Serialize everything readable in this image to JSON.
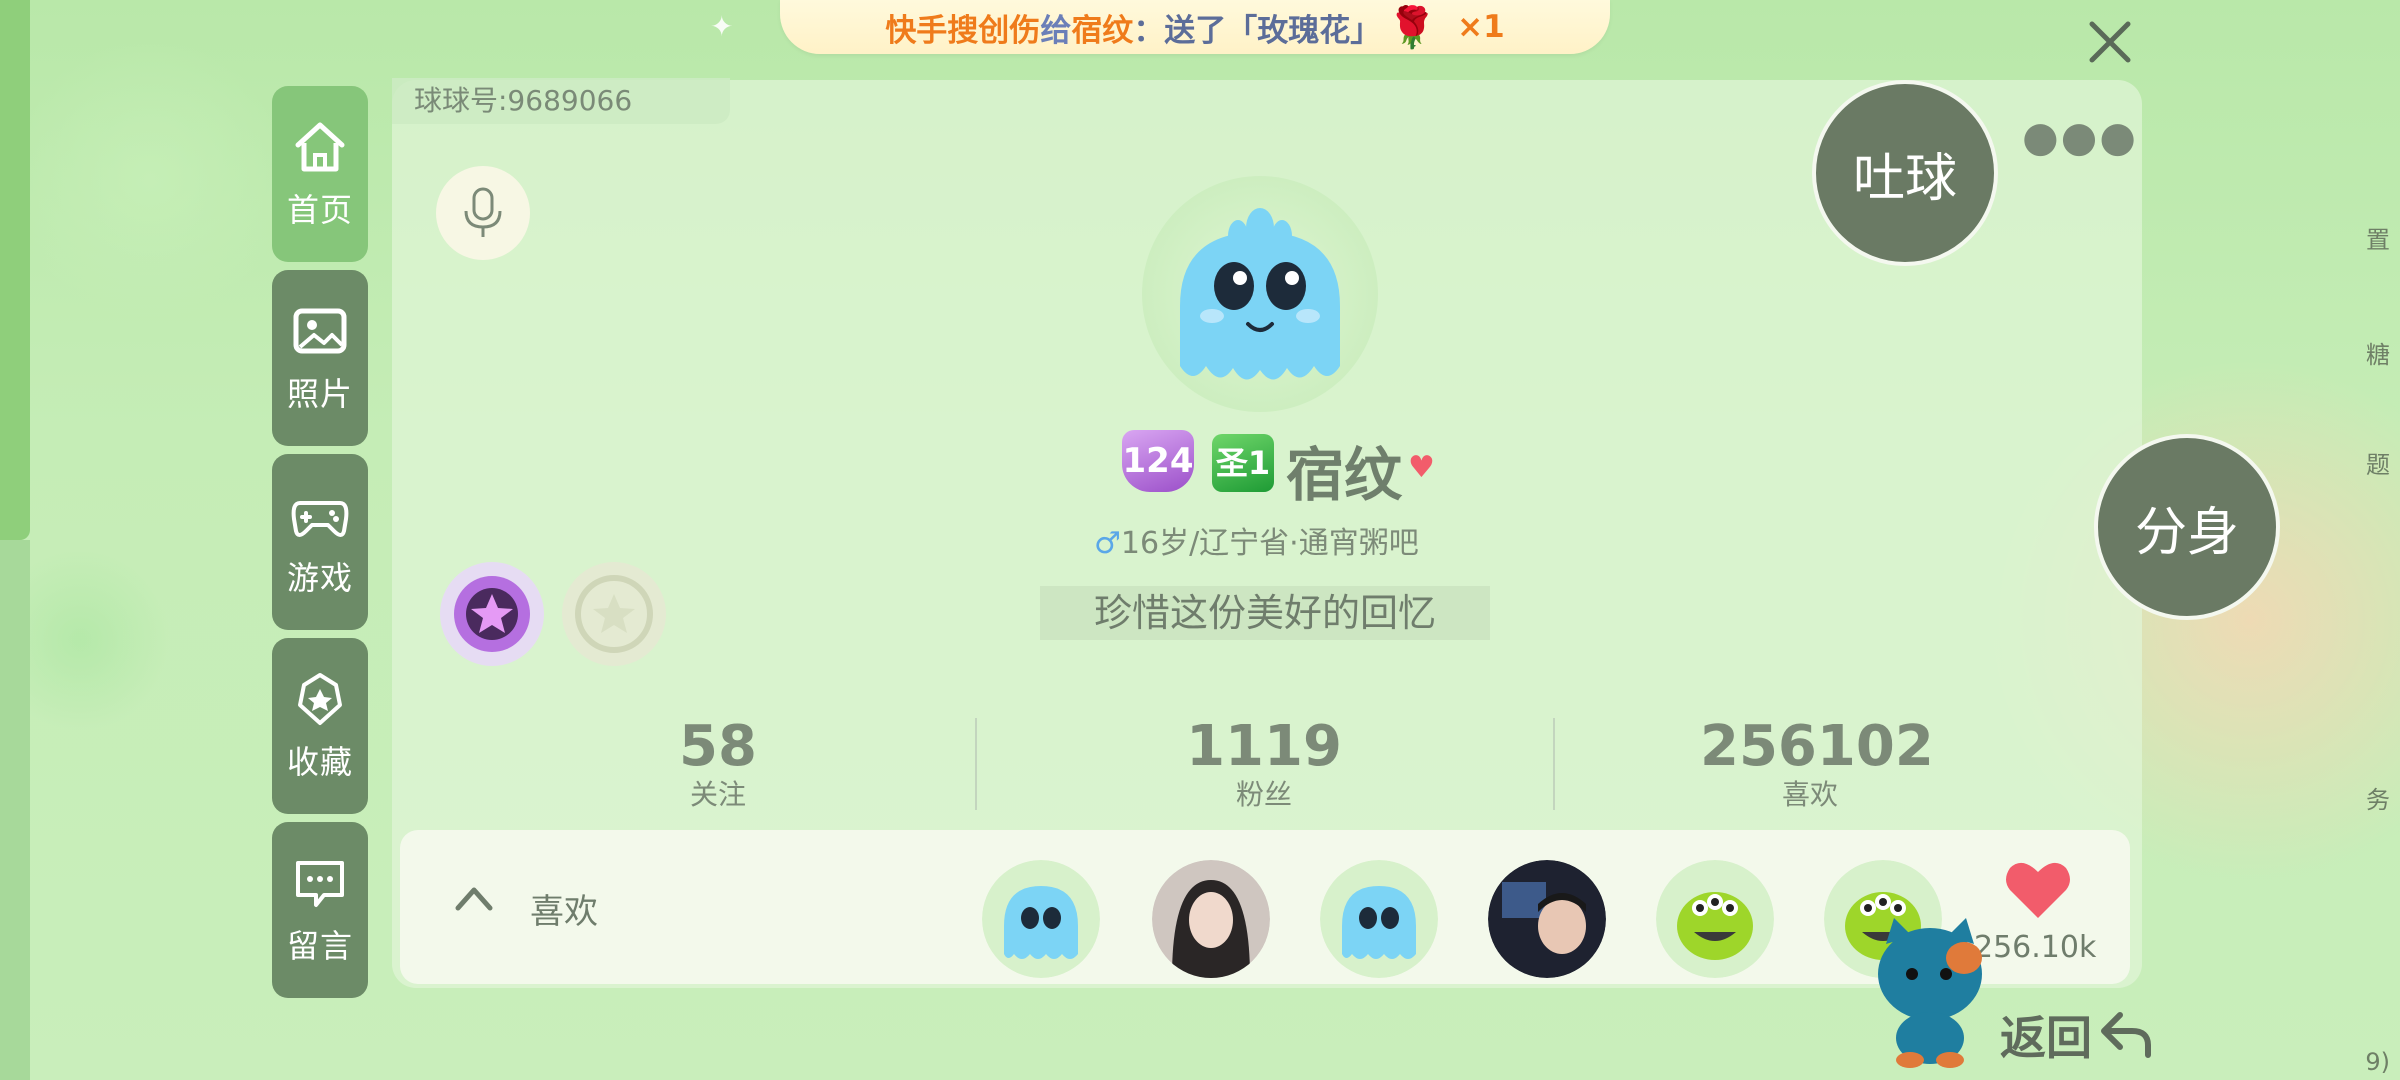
{
  "gift_banner": {
    "sender": "快手搜创伤",
    "connector": "给",
    "receiver": "宿纹",
    "action": "：送了「玫瑰花」",
    "count": "×1"
  },
  "sidebar": {
    "items": [
      {
        "label": "首页",
        "icon": "home-icon",
        "active": true
      },
      {
        "label": "照片",
        "icon": "photo-icon",
        "active": false
      },
      {
        "label": "游戏",
        "icon": "gamepad-icon",
        "active": false
      },
      {
        "label": "收藏",
        "icon": "star-icon",
        "active": false
      },
      {
        "label": "留言",
        "icon": "message-icon",
        "active": false
      }
    ]
  },
  "profile": {
    "ball_id": "球球号:9689066",
    "level": "124",
    "saint_badge": "圣1",
    "nickname": "宿纹",
    "info": "16岁/辽宁省·通宵粥吧",
    "gender_symbol": "♂",
    "signature": "珍惜这份美好的回忆"
  },
  "stats": [
    {
      "value": "58",
      "label": "关注"
    },
    {
      "value": "1119",
      "label": "粉丝"
    },
    {
      "value": "256102",
      "label": "喜欢"
    }
  ],
  "likes": {
    "title": "喜欢",
    "total": "256.10k"
  },
  "actions": {
    "spit": "吐球",
    "clone": "分身",
    "back": "返回"
  },
  "edge_text": [
    "置",
    "糖",
    "题",
    "务",
    "9)"
  ],
  "colors": {
    "accent": "#86c67a",
    "nav_bg": "#6c8b67",
    "heart": "#f25c6b"
  }
}
